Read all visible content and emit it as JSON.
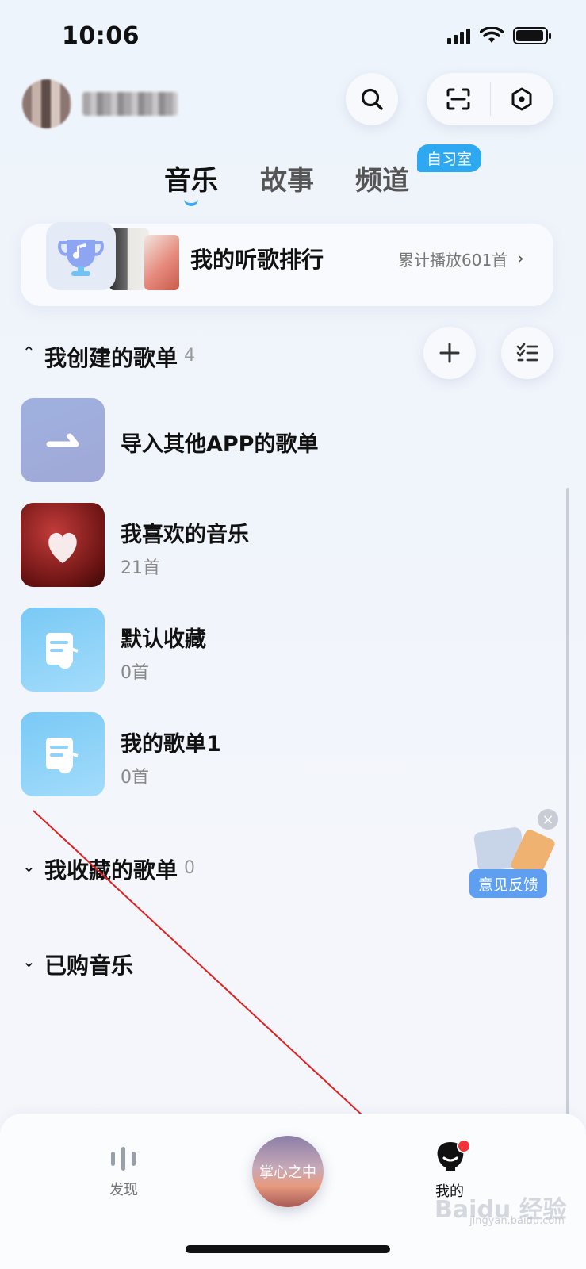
{
  "status_bar": {
    "time": "10:06"
  },
  "header": {
    "search_icon": "search-icon",
    "scan_icon": "scan-icon",
    "settings_icon": "hexagon-settings-icon"
  },
  "tabs": [
    {
      "label": "音乐",
      "active": true
    },
    {
      "label": "故事",
      "active": false
    },
    {
      "label": "频道",
      "active": false
    }
  ],
  "tab_badge": "自习室",
  "ranking": {
    "title": "我的听歌排行",
    "count_text": "累计播放601首"
  },
  "created_section": {
    "title": "我创建的歌单",
    "count": "4",
    "playlists": [
      {
        "name": "导入其他APP的歌单",
        "sub": ""
      },
      {
        "name": "我喜欢的音乐",
        "sub": "21首"
      },
      {
        "name": "默认收藏",
        "sub": "0首"
      },
      {
        "name": "我的歌单1",
        "sub": "0首"
      }
    ]
  },
  "collected_section": {
    "title": "我收藏的歌单",
    "count": "0"
  },
  "purchased_section": {
    "title": "已购音乐"
  },
  "feedback": {
    "label": "意见反馈"
  },
  "bottom_nav": {
    "discover_label": "发现",
    "now_playing_title": "掌心之中",
    "mine_label": "我的"
  },
  "watermark": {
    "main": "Baidu 经验",
    "sub": "jingyan.baidu.com"
  },
  "colors": {
    "accent": "#2ea8f0",
    "badge_red": "#f2333a",
    "feedback_blue": "#5e9ff2"
  }
}
